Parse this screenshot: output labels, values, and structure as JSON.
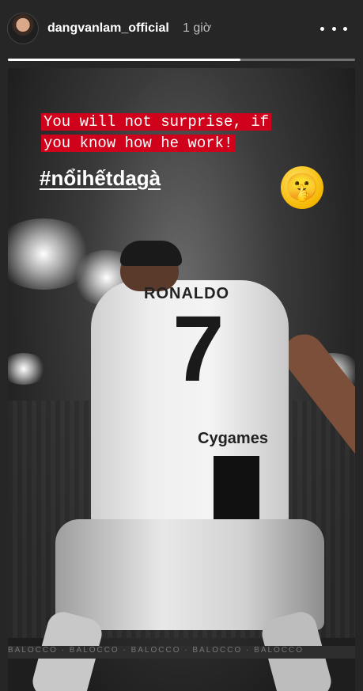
{
  "header": {
    "username": "dangvanlam_official",
    "time": "1 giờ",
    "more_icon": "more-horizontal-icon"
  },
  "progress": {
    "fraction": 0.67
  },
  "story": {
    "caption_line1": "You will not surprise, if",
    "caption_line2": "you know how he work!",
    "hashtag": "#nổihếtdagà",
    "emoji": "🤫",
    "shirt_name": "RONALDO",
    "shirt_number": "7",
    "sponsor": "Cygames",
    "ad_text": "BALOCCO · BALOCCO · BALOCCO · BALOCCO · BALOCCO"
  },
  "colors": {
    "caption_bg": "#d0021b",
    "background": "#262626"
  }
}
